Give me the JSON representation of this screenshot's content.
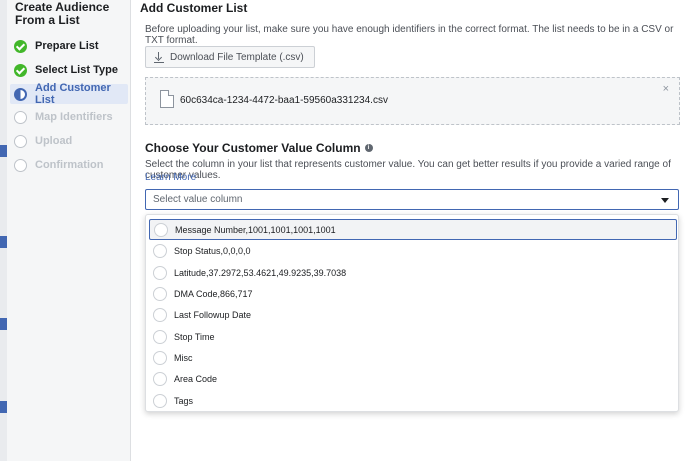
{
  "sidebar": {
    "title": "Create Audience From a List",
    "steps": [
      {
        "label": "Prepare List",
        "state": "done"
      },
      {
        "label": "Select List Type",
        "state": "done"
      },
      {
        "label": "Add Customer List",
        "state": "active"
      },
      {
        "label": "Map Identifiers",
        "state": "todo"
      },
      {
        "label": "Upload",
        "state": "todo"
      },
      {
        "label": "Confirmation",
        "state": "todo"
      }
    ]
  },
  "main": {
    "title": "Add Customer List",
    "intro": "Before uploading your list, make sure you have enough identifiers in the correct format. The list needs to be in a CSV or TXT format.",
    "download_label": "Download File Template (.csv)",
    "file": {
      "name": "60c634ca-1234-4472-baa1-59560a331234.csv",
      "close_glyph": "×"
    },
    "value_column": {
      "title": "Choose Your Customer Value Column",
      "info_glyph": "i",
      "description": "Select the column in your list that represents customer value. You can get better results if you provide a varied range of customer values.",
      "learn_more": "Learn More",
      "placeholder": "Select value column",
      "options": [
        "Message Number,1001,1001,1001,1001",
        "Stop Status,0,0,0,0",
        "Latitude,37.2972,53.4621,49.9235,39.7038",
        "DMA Code,866,717",
        "Last Followup Date",
        "Stop Time",
        "Misc",
        "Area Code",
        "Tags"
      ]
    }
  },
  "colors": {
    "accent": "#4267b2",
    "done": "#42b72a",
    "disabled": "#bec3c9"
  },
  "icons": {
    "step_done": "check-circle-icon",
    "step_active": "half-circle-icon",
    "step_todo": "empty-circle-icon",
    "download": "download-icon",
    "file": "document-icon",
    "close": "close-icon",
    "info": "info-icon",
    "caret": "caret-down-icon",
    "option": "radio-icon"
  }
}
